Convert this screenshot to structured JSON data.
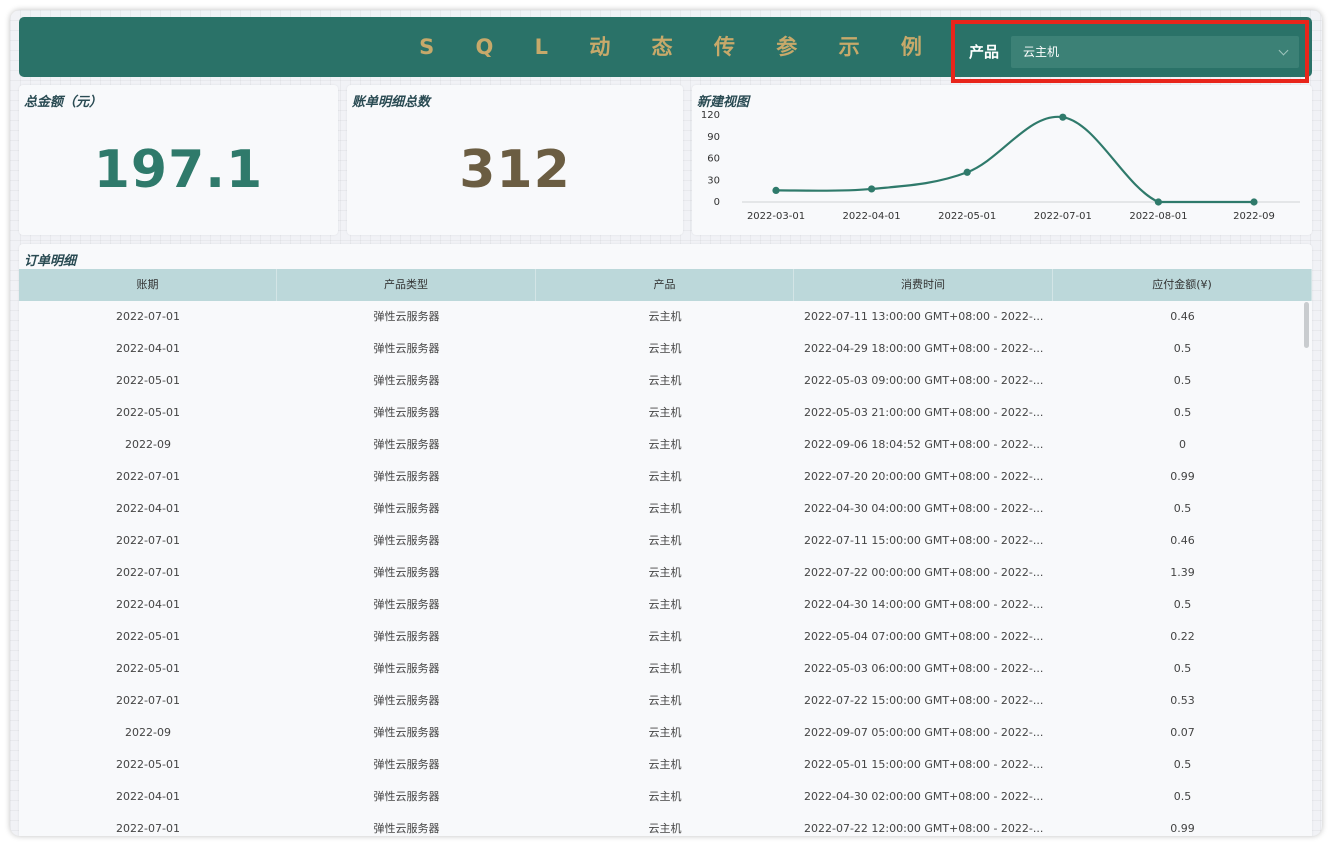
{
  "header": {
    "title": "S Q L 动 态 传 参 示 例",
    "filter_label": "产品",
    "filter_value": "云主机"
  },
  "kpi_total": {
    "title": "总金额（元）",
    "value": "197.1",
    "color": "#2f7a6b"
  },
  "kpi_count": {
    "title": "账单明细总数",
    "value": "312",
    "color": "#6b5d42"
  },
  "chart": {
    "title": "新建视图"
  },
  "chart_data": {
    "type": "line",
    "title": "新建视图",
    "categories": [
      "2022-03-01",
      "2022-04-01",
      "2022-05-01",
      "2022-07-01",
      "2022-08-01",
      "2022-09"
    ],
    "series": [
      {
        "values": [
          16,
          18,
          41,
          117,
          0,
          0
        ]
      }
    ],
    "yticks": [
      0,
      30,
      60,
      90,
      120
    ],
    "ylim": [
      0,
      120
    ],
    "line_color": "#2f7a6b",
    "grid": false
  },
  "table": {
    "title": "订单明细",
    "columns": [
      "账期",
      "产品类型",
      "产品",
      "消费时间",
      "应付金额(¥)"
    ],
    "rows": [
      [
        "2022-07-01",
        "弹性云服务器",
        "云主机",
        "2022-07-11 13:00:00 GMT+08:00 - 2022-...",
        "0.46"
      ],
      [
        "2022-04-01",
        "弹性云服务器",
        "云主机",
        "2022-04-29 18:00:00 GMT+08:00 - 2022-...",
        "0.5"
      ],
      [
        "2022-05-01",
        "弹性云服务器",
        "云主机",
        "2022-05-03 09:00:00 GMT+08:00 - 2022-...",
        "0.5"
      ],
      [
        "2022-05-01",
        "弹性云服务器",
        "云主机",
        "2022-05-03 21:00:00 GMT+08:00 - 2022-...",
        "0.5"
      ],
      [
        "2022-09",
        "弹性云服务器",
        "云主机",
        "2022-09-06 18:04:52 GMT+08:00 - 2022-...",
        "0"
      ],
      [
        "2022-07-01",
        "弹性云服务器",
        "云主机",
        "2022-07-20 20:00:00 GMT+08:00 - 2022-...",
        "0.99"
      ],
      [
        "2022-04-01",
        "弹性云服务器",
        "云主机",
        "2022-04-30 04:00:00 GMT+08:00 - 2022-...",
        "0.5"
      ],
      [
        "2022-07-01",
        "弹性云服务器",
        "云主机",
        "2022-07-11 15:00:00 GMT+08:00 - 2022-...",
        "0.46"
      ],
      [
        "2022-07-01",
        "弹性云服务器",
        "云主机",
        "2022-07-22 00:00:00 GMT+08:00 - 2022-...",
        "1.39"
      ],
      [
        "2022-04-01",
        "弹性云服务器",
        "云主机",
        "2022-04-30 14:00:00 GMT+08:00 - 2022-...",
        "0.5"
      ],
      [
        "2022-05-01",
        "弹性云服务器",
        "云主机",
        "2022-05-04 07:00:00 GMT+08:00 - 2022-...",
        "0.22"
      ],
      [
        "2022-05-01",
        "弹性云服务器",
        "云主机",
        "2022-05-03 06:00:00 GMT+08:00 - 2022-...",
        "0.5"
      ],
      [
        "2022-07-01",
        "弹性云服务器",
        "云主机",
        "2022-07-22 15:00:00 GMT+08:00 - 2022-...",
        "0.53"
      ],
      [
        "2022-09",
        "弹性云服务器",
        "云主机",
        "2022-09-07 05:00:00 GMT+08:00 - 2022-...",
        "0.07"
      ],
      [
        "2022-05-01",
        "弹性云服务器",
        "云主机",
        "2022-05-01 15:00:00 GMT+08:00 - 2022-...",
        "0.5"
      ],
      [
        "2022-04-01",
        "弹性云服务器",
        "云主机",
        "2022-04-30 02:00:00 GMT+08:00 - 2022-...",
        "0.5"
      ],
      [
        "2022-07-01",
        "弹性云服务器",
        "云主机",
        "2022-07-22 12:00:00 GMT+08:00 - 2022-...",
        "0.99"
      ]
    ]
  }
}
